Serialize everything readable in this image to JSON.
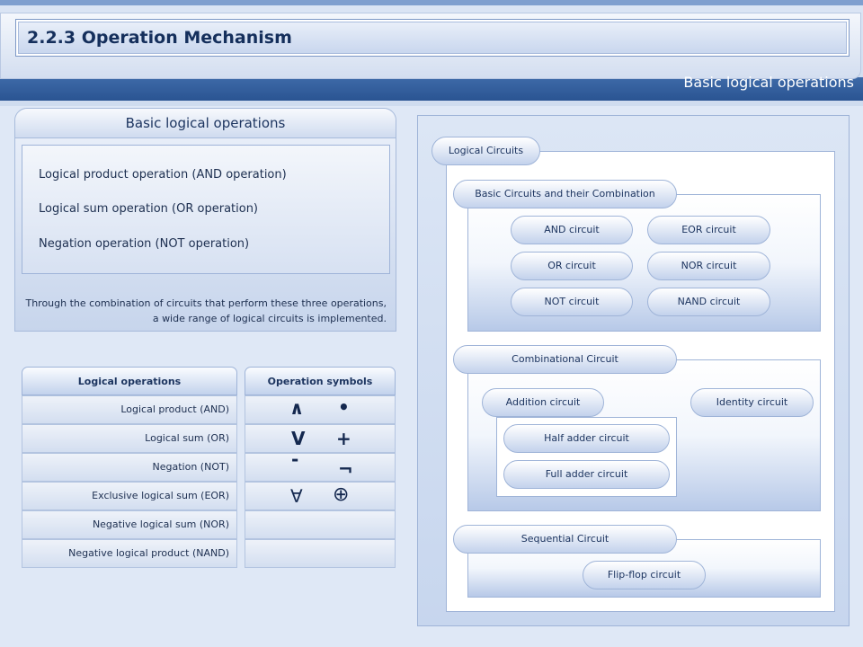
{
  "header": {
    "title": "2.2.3 Operation Mechanism",
    "subtitle": "Basic logical operations"
  },
  "left_panel": {
    "title": "Basic logical operations",
    "items": [
      "Logical product operation (AND operation)",
      "Logical sum operation (OR operation)",
      "Negation operation (NOT operation)"
    ],
    "note_line1": "Through the combination of circuits that perform these three operations,",
    "note_line2": "a wide range of logical circuits is implemented."
  },
  "table": {
    "col_operations": "Logical operations",
    "col_symbols": "Operation symbols",
    "rows": [
      {
        "label": "Logical product (AND)",
        "sym1": "∧",
        "sym2": "•"
      },
      {
        "label": "Logical sum (OR)",
        "sym1": "V",
        "sym2": "+"
      },
      {
        "label": "Negation (NOT)",
        "sym1": "-",
        "sym2": "¬"
      },
      {
        "label": "Exclusive logical sum (EOR)",
        "sym1": "∀",
        "sym2": "⊕"
      },
      {
        "label": "Negative logical sum (NOR)",
        "sym1": "",
        "sym2": ""
      },
      {
        "label": "Negative logical product (NAND)",
        "sym1": "",
        "sym2": ""
      }
    ]
  },
  "diagram": {
    "logical_circuits": "Logical Circuits",
    "basic": {
      "title": "Basic Circuits and their Combination",
      "and": "AND circuit",
      "or": "OR circuit",
      "not": "NOT circuit",
      "eor": "EOR circuit",
      "nor": "NOR circuit",
      "nand": "NAND circuit"
    },
    "combinational": {
      "title": "Combinational Circuit",
      "addition": "Addition circuit",
      "identity": "Identity circuit",
      "half_adder": "Half adder circuit",
      "full_adder": "Full adder circuit"
    },
    "sequential": {
      "title": "Sequential Circuit",
      "flipflop": "Flip-flop circuit"
    }
  }
}
